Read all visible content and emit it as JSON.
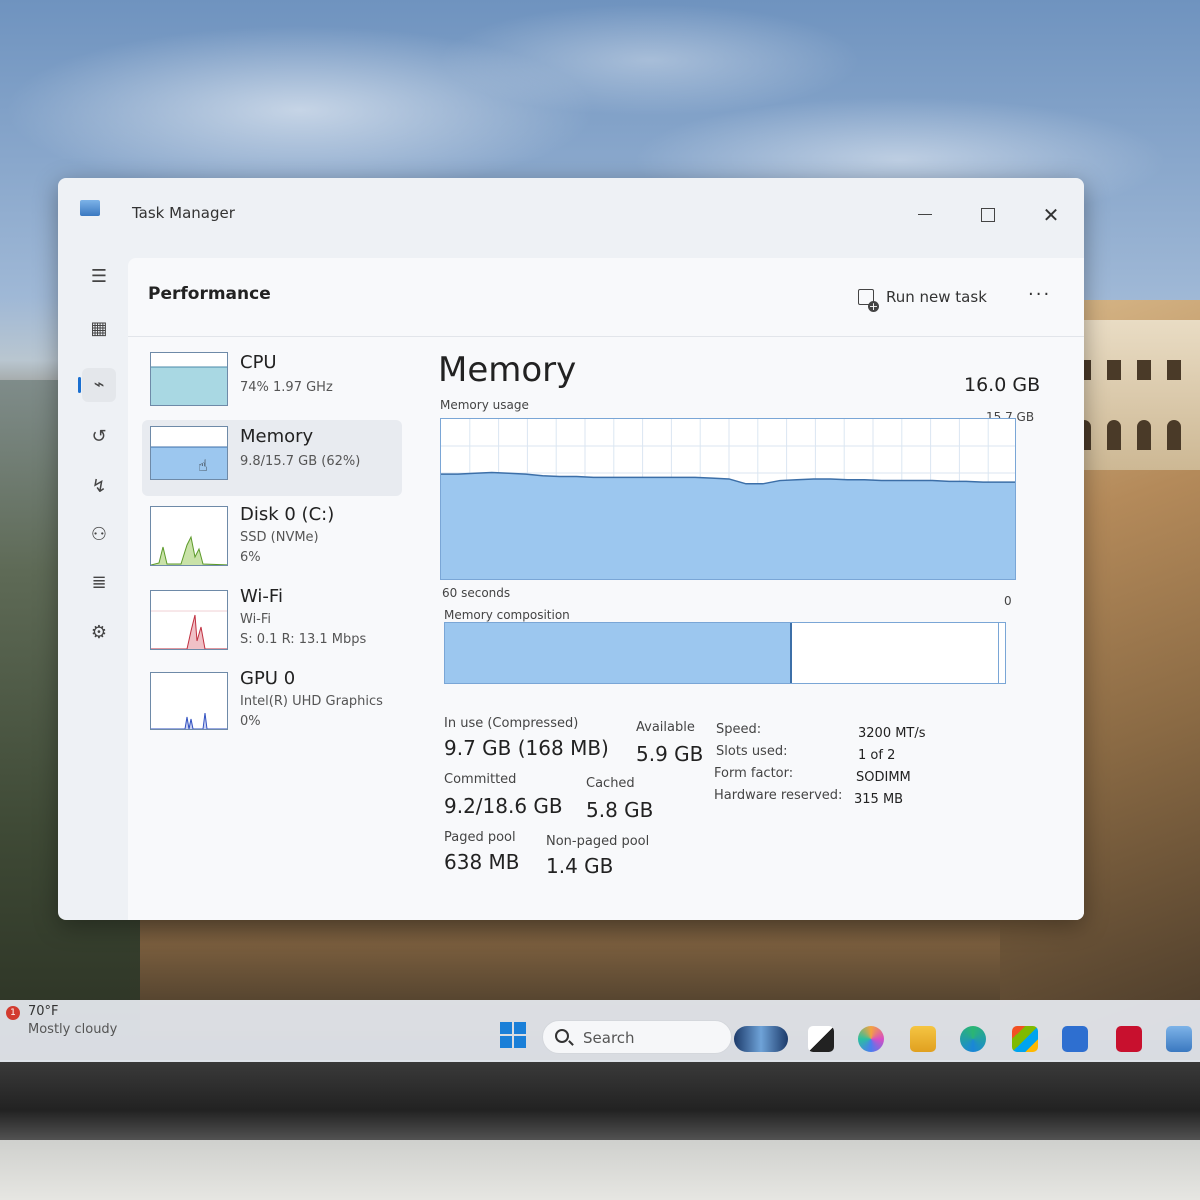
{
  "taskbar": {
    "weather_badge": "1",
    "weather_temp": "70°F",
    "weather_condition": "Mostly cloudy",
    "search_label": "Search",
    "icons": [
      "copilot-icon",
      "task-view-icon",
      "copilot-colorful-icon",
      "file-explorer-icon",
      "edge-icon",
      "store-icon",
      "app-icon",
      "mcafee-icon",
      "task-manager-icon"
    ]
  },
  "window": {
    "title": "Task Manager",
    "minimize_glyph": "",
    "close_glyph": "✕"
  },
  "nav_icons": [
    "hamburger-icon",
    "processes-icon",
    "performance-icon",
    "app-history-icon",
    "startup-icon",
    "users-icon",
    "details-icon",
    "services-icon",
    "settings-icon"
  ],
  "header": {
    "title": "Performance",
    "run_new_task": "Run new task",
    "more": "···"
  },
  "resources": [
    {
      "name": "CPU",
      "line1": "74%  1.97 GHz"
    },
    {
      "name": "Memory",
      "line1": "9.8/15.7 GB (62%)"
    },
    {
      "name": "Disk 0 (C:)",
      "line1": "SSD (NVMe)",
      "line2": "6%"
    },
    {
      "name": "Wi-Fi",
      "line1": "Wi-Fi",
      "line2": "S: 0.1  R: 13.1 Mbps"
    },
    {
      "name": "GPU 0",
      "line1": "Intel(R) UHD Graphics",
      "line2": "0%"
    }
  ],
  "memory": {
    "title": "Memory",
    "total": "16.0 GB",
    "usage_label": "Memory usage",
    "usage_max": "15.7 GB",
    "time_label": "60 seconds",
    "min_label": "0",
    "composition_label": "Memory composition",
    "in_use_label": "In use (Compressed)",
    "in_use_value": "9.7 GB (168 MB)",
    "available_label": "Available",
    "available_value": "5.9 GB",
    "committed_label": "Committed",
    "committed_value": "9.2/18.6 GB",
    "cached_label": "Cached",
    "cached_value": "5.8 GB",
    "paged_label": "Paged pool",
    "paged_value": "638 MB",
    "nonpaged_label": "Non-paged pool",
    "nonpaged_value": "1.4 GB",
    "specs": [
      {
        "label": "Speed:",
        "value": "3200 MT/s"
      },
      {
        "label": "Slots used:",
        "value": "1 of 2"
      },
      {
        "label": "Form factor:",
        "value": "SODIMM"
      },
      {
        "label": "Hardware reserved:",
        "value": "315 MB"
      }
    ],
    "usage_fraction_series": [
      0.66,
      0.66,
      0.665,
      0.67,
      0.665,
      0.66,
      0.65,
      0.645,
      0.645,
      0.64,
      0.64,
      0.64,
      0.64,
      0.64,
      0.64,
      0.64,
      0.635,
      0.63,
      0.6,
      0.6,
      0.62,
      0.625,
      0.63,
      0.63,
      0.625,
      0.625,
      0.62,
      0.62,
      0.62,
      0.62,
      0.615,
      0.615,
      0.61,
      0.61,
      0.61
    ],
    "composition_in_use_fraction": 0.62
  },
  "colors": {
    "accent": "#1a6fd0",
    "memory_fill": "#9cc7ef",
    "memory_line": "#3c6fa8",
    "cpu_fill": "#a9d8e3",
    "disk_line": "#5c9a2a",
    "wifi_line": "#c03040",
    "gpu_line": "#3050c0"
  }
}
